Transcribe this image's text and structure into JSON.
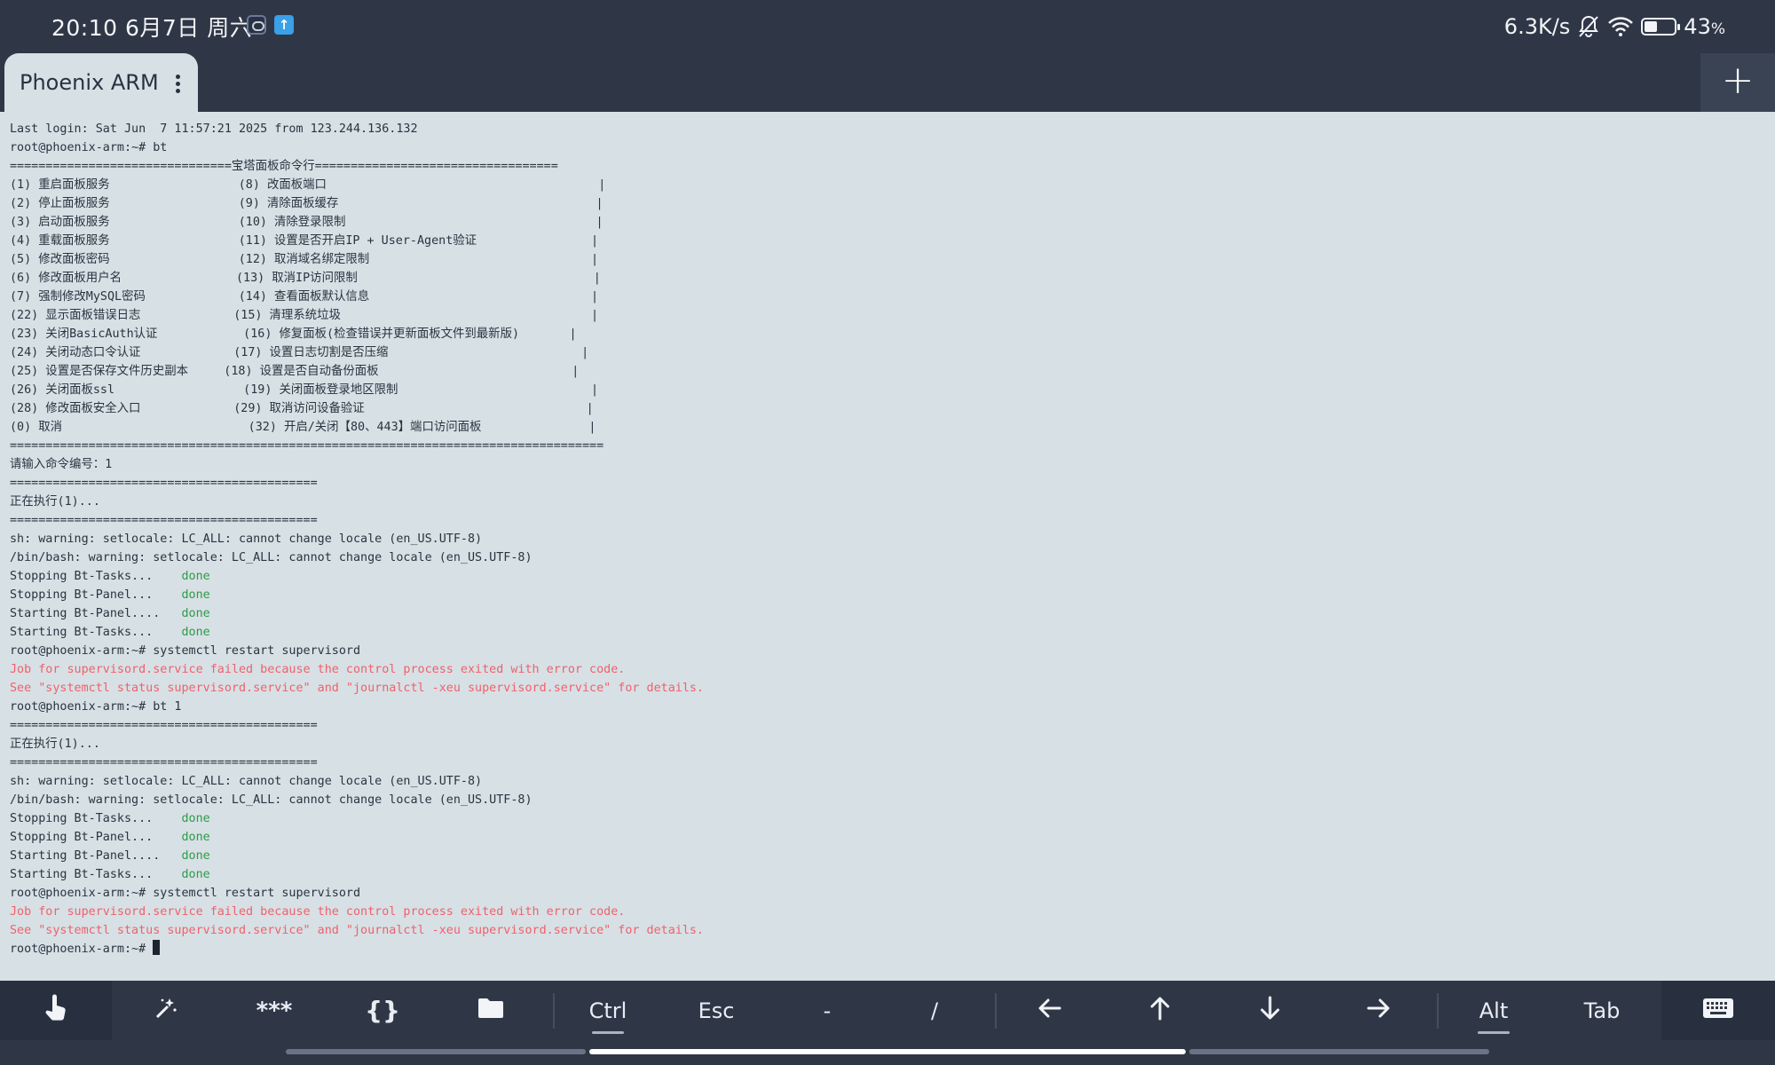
{
  "status_bar": {
    "time_date": "20:10  6月7日 周六",
    "net_speed": "6.3K/s",
    "battery_level": 0.43,
    "battery_label": "43",
    "battery_unit": "%"
  },
  "tab": {
    "title": "Phoenix ARM",
    "new_tab_label": "+"
  },
  "terminal": {
    "lines": [
      {
        "text": "Last login: Sat Jun  7 11:57:21 2025 from 123.244.136.132"
      },
      {
        "text": "root@phoenix-arm:~# bt"
      },
      {
        "text": "===============================宝塔面板命令行=================================="
      },
      {
        "text": "(1) 重启面板服务                  (8) 改面板端口                                      |"
      },
      {
        "text": "(2) 停止面板服务                  (9) 清除面板缓存                                    |"
      },
      {
        "text": "(3) 启动面板服务                  (10) 清除登录限制                                   |"
      },
      {
        "text": "(4) 重载面板服务                  (11) 设置是否开启IP + User-Agent验证                |"
      },
      {
        "text": "(5) 修改面板密码                  (12) 取消域名绑定限制                               |"
      },
      {
        "text": "(6) 修改面板用户名                (13) 取消IP访问限制                                 |"
      },
      {
        "text": "(7) 强制修改MySQL密码             (14) 查看面板默认信息                               |"
      },
      {
        "text": "(22) 显示面板错误日志             (15) 清理系统垃圾                                   |"
      },
      {
        "text": "(23) 关闭BasicAuth认证            (16) 修复面板(检查错误并更新面板文件到最新版)       |"
      },
      {
        "text": "(24) 关闭动态口令认证             (17) 设置日志切割是否压缩                           |"
      },
      {
        "text": "(25) 设置是否保存文件历史副本     (18) 设置是否自动备份面板                           |"
      },
      {
        "text": "(26) 关闭面板ssl                  (19) 关闭面板登录地区限制                           |"
      },
      {
        "text": "(28) 修改面板安全入口             (29) 取消访问设备验证                               |"
      },
      {
        "text": "(0) 取消                          (32) 开启/关闭【80、443】端口访问面板               |"
      },
      {
        "text": "==================================================================================="
      },
      {
        "text": "请输入命令编号：1"
      },
      {
        "text": "==========================================="
      },
      {
        "text": "正在执行(1)..."
      },
      {
        "text": "==========================================="
      },
      {
        "text": "sh: warning: setlocale: LC_ALL: cannot change locale (en_US.UTF-8)"
      },
      {
        "text": "/bin/bash: warning: setlocale: LC_ALL: cannot change locale (en_US.UTF-8)"
      },
      {
        "text": "Stopping Bt-Tasks...    ",
        "status": "done"
      },
      {
        "text": "Stopping Bt-Panel...    ",
        "status": "done"
      },
      {
        "text": "Starting Bt-Panel....   ",
        "status": "done"
      },
      {
        "text": "Starting Bt-Tasks...    ",
        "status": "done"
      },
      {
        "text": "root@phoenix-arm:~# systemctl restart supervisord"
      },
      {
        "text": "Job for supervisord.service failed because the control process exited with error code.",
        "type": "error"
      },
      {
        "text": "See \"systemctl status supervisord.service\" and \"journalctl -xeu supervisord.service\" for details.",
        "type": "error"
      },
      {
        "text": "root@phoenix-arm:~# bt 1"
      },
      {
        "text": "==========================================="
      },
      {
        "text": "正在执行(1)..."
      },
      {
        "text": "==========================================="
      },
      {
        "text": "sh: warning: setlocale: LC_ALL: cannot change locale (en_US.UTF-8)"
      },
      {
        "text": "/bin/bash: warning: setlocale: LC_ALL: cannot change locale (en_US.UTF-8)"
      },
      {
        "text": "Stopping Bt-Tasks...    ",
        "status": "done"
      },
      {
        "text": "Stopping Bt-Panel...    ",
        "status": "done"
      },
      {
        "text": "Starting Bt-Panel....   ",
        "status": "done"
      },
      {
        "text": "Starting Bt-Tasks...    ",
        "status": "done"
      },
      {
        "text": "root@phoenix-arm:~# systemctl restart supervisord"
      },
      {
        "text": "Job for supervisord.service failed because the control process exited with error code.",
        "type": "error"
      },
      {
        "text": "See \"systemctl status supervisord.service\" and \"journalctl -xeu supervisord.service\" for details.",
        "type": "error"
      },
      {
        "text": "root@phoenix-arm:~# ",
        "cursor": true
      }
    ]
  },
  "keybar": {
    "touch_icon": "hand-pointer-icon",
    "magic_icon": "magic-wand-icon",
    "password_label": "***",
    "snippet_label": "{}",
    "folder_icon": "folder-icon",
    "ctrl_label": "Ctrl",
    "esc_label": "Esc",
    "dash_label": "-",
    "slash_label": "/",
    "left_icon": "arrow-left-icon",
    "up_icon": "arrow-up-icon",
    "down_icon": "arrow-down-icon",
    "right_icon": "arrow-right-icon",
    "alt_label": "Alt",
    "tab_label": "Tab",
    "keyboard_icon": "keyboard-icon"
  },
  "colors": {
    "chrome_bg": "#2f3747",
    "terminal_bg": "#d7e0e5",
    "terminal_fg": "#2b3340",
    "error_fg": "#f0616b",
    "done_fg": "#2e9b47"
  }
}
